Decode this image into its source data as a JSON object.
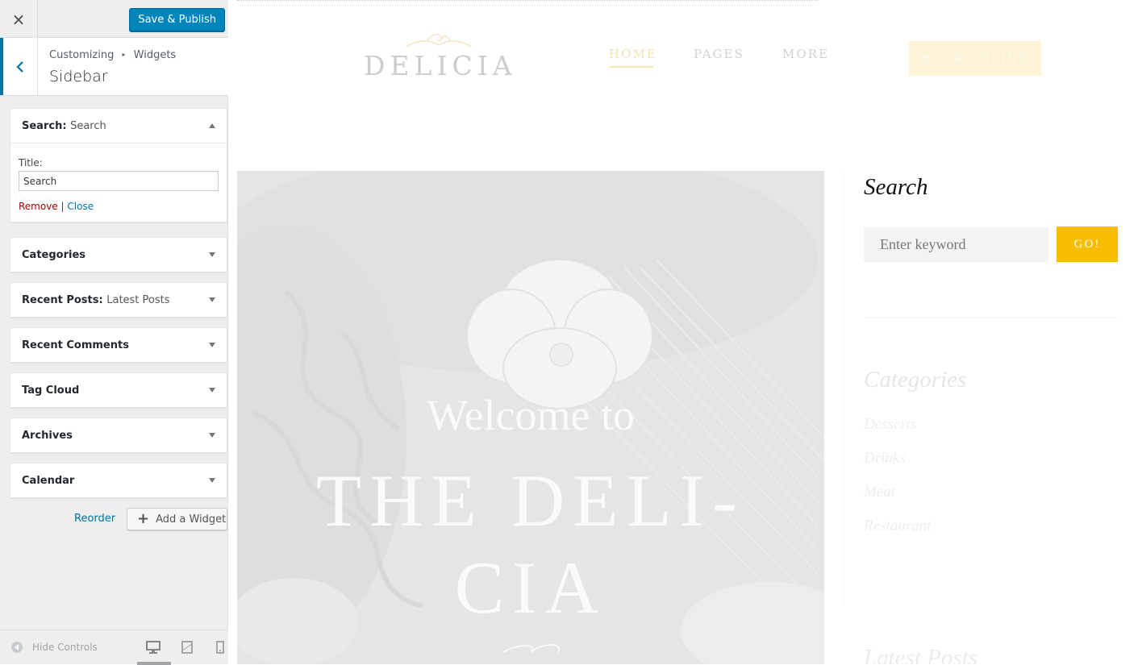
{
  "customizer": {
    "close_icon": "×",
    "save_label": "Save & Publish",
    "breadcrumb": {
      "root": "Customizing",
      "separator": "▸",
      "section": "Widgets"
    },
    "title": "Sidebar",
    "widgets": [
      {
        "name": "Search",
        "subtitle": "Search",
        "expanded": true
      },
      {
        "name": "Categories",
        "subtitle": ""
      },
      {
        "name": "Recent Posts",
        "subtitle": "Latest Posts"
      },
      {
        "name": "Recent Comments",
        "subtitle": ""
      },
      {
        "name": "Tag Cloud",
        "subtitle": ""
      },
      {
        "name": "Archives",
        "subtitle": ""
      },
      {
        "name": "Calendar",
        "subtitle": ""
      }
    ],
    "search_widget": {
      "title_label": "Title:",
      "title_value": "Search",
      "remove_label": "Remove",
      "divider": "|",
      "close_label": "Close"
    },
    "reorder_label": "Reorder",
    "add_widget_label": "Add a Widget",
    "hide_controls_label": "Hide Controls",
    "accent_color": "#0073aa",
    "save_color": "#0085ba"
  },
  "preview": {
    "logo": "DELICIA",
    "nav": [
      "HOME",
      "PAGES",
      "MORE"
    ],
    "book_label": "BOOK ONLINE",
    "hero": {
      "line1": "Welcome to",
      "line2": "THE DELI-",
      "line3": "CIA"
    },
    "sidebar": {
      "search_title": "Search",
      "search_placeholder": "Enter keyword",
      "go_label": "GO!",
      "categories_title": "Categories",
      "categories": [
        "Desserts",
        "Drinks",
        "Meat",
        "Restaurant"
      ],
      "latest_title": "Latest Posts"
    },
    "accent_color": "#f8bd00"
  }
}
